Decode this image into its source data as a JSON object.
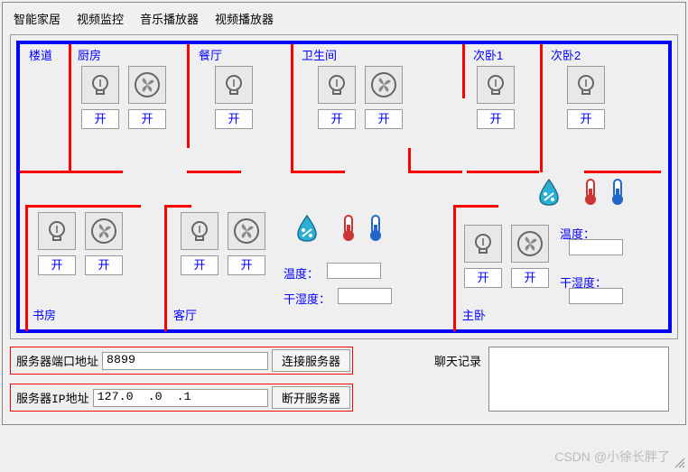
{
  "menu": {
    "smarthome": "智能家居",
    "video_monitor": "视频监控",
    "music_player": "音乐播放器",
    "video_player": "视频播放器"
  },
  "rooms": {
    "corridor": "楼道",
    "kitchen": "厨房",
    "dining": "餐厅",
    "bathroom": "卫生间",
    "bedroom2a": "次卧1",
    "bedroom2b": "次卧2",
    "study": "书房",
    "living": "客厅",
    "master": "主卧"
  },
  "btn_on": "开",
  "sensors": {
    "temp_label": "温度：",
    "humid_label": "干湿度："
  },
  "server": {
    "port_label": "服务器端口地址",
    "port_value": "8899",
    "connect": "连接服务器",
    "ip_label": "服务器IP地址",
    "ip_value": "127.0  .0  .1",
    "disconnect": "断开服务器"
  },
  "chat": {
    "label": "聊天记录"
  },
  "watermark": "CSDN @小徐长胖了"
}
